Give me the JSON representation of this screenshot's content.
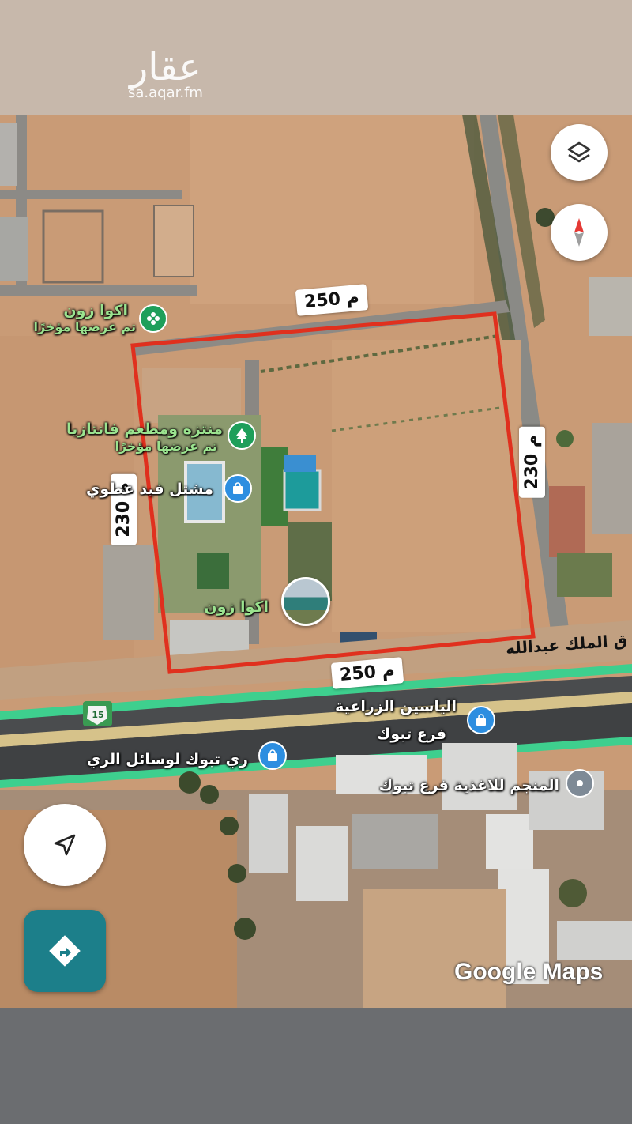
{
  "watermark": {
    "logo": "عقار",
    "url": "sa.aqar.fm"
  },
  "map": {
    "brand": "Google Maps",
    "highway_shield": "15",
    "road_name": "ق الملك عبدالله",
    "dimensions": {
      "top": "250 م",
      "bottom": "250 م",
      "left": "230 م",
      "right": "230 م"
    },
    "places": [
      {
        "name": "اكوا زون",
        "sub": "تم عرضها مؤخرًا",
        "icon": "flower-pin-icon"
      },
      {
        "name": "منتزه ومطعم فانتازيا",
        "sub": "تم عرضها مؤخرًا",
        "icon": "tree-pin-icon"
      },
      {
        "name": "مشتل فيد   عطوي",
        "icon": "shopping-bag-pin-icon"
      },
      {
        "name": "اكوا زون",
        "icon": "photo-pin-icon"
      },
      {
        "name": "الياسين الزراعية",
        "sub": "فرع تبوك",
        "icon": "shopping-bag-pin-icon"
      },
      {
        "name": "ري تبوك لوسائل الري",
        "icon": "shopping-bag-pin-icon"
      },
      {
        "name": "المنجم للاغذية فرع تبوك",
        "icon": "location-pin-icon"
      }
    ],
    "controls": {
      "layers": "layers-icon",
      "compass": "compass-icon",
      "locate": "navigation-arrow-icon",
      "directions": "directions-icon"
    },
    "colors": {
      "boundary": "#e0301e",
      "highway": "#3ecf8e",
      "directions_button": "#1c7f8a"
    }
  }
}
